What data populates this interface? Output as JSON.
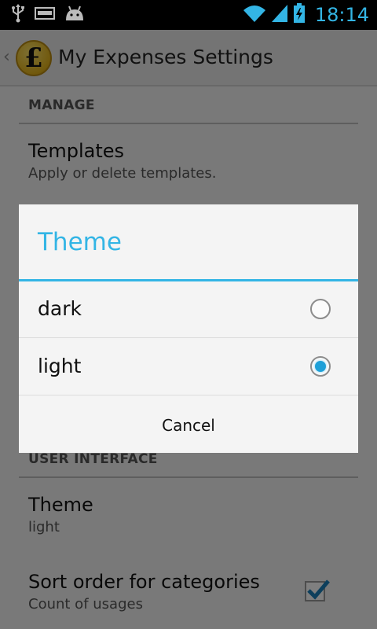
{
  "status_bar": {
    "icons": [
      "usb-icon",
      "weatherbug-icon",
      "android-icon",
      "wifi-icon",
      "cell-signal-icon",
      "battery-charging-icon"
    ],
    "time": "18:14",
    "accent": "#33b5e5"
  },
  "action_bar": {
    "app_icon_symbol": "£",
    "title": "My Expenses Settings"
  },
  "settings": {
    "manage_header": "MANAGE",
    "templates": {
      "title": "Templates",
      "summary": "Apply or delete templates."
    },
    "ui_header": "USER INTERFACE",
    "theme": {
      "title": "Theme",
      "summary": "light"
    },
    "sort_order": {
      "title": "Sort order for categories",
      "summary": "Count of usages",
      "checked": true
    }
  },
  "dialog": {
    "title": "Theme",
    "options": [
      {
        "label": "dark",
        "selected": false
      },
      {
        "label": "light",
        "selected": true
      }
    ],
    "cancel_label": "Cancel"
  },
  "colors": {
    "accent": "#33b5e5",
    "radio_selected": "#1fa0d8"
  }
}
